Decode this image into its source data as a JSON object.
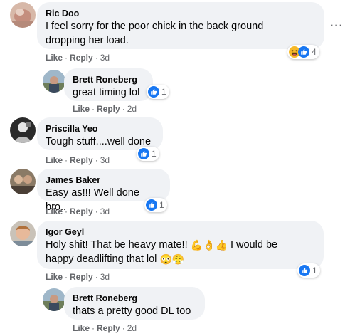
{
  "comments": [
    {
      "author": "Ric Doo",
      "text_line1": "I feel sorry for the poor chick in the back ground",
      "text_line2": "dropping her load.",
      "like": "Like",
      "reply": "Reply",
      "time": "3d",
      "reaction_count": "4",
      "reactions": [
        "haha-icon",
        "like-icon"
      ],
      "replies": [
        {
          "author": "Brett Roneberg",
          "text": "great timing lol",
          "like": "Like",
          "reply": "Reply",
          "time": "2d",
          "reaction_count": "1"
        }
      ]
    },
    {
      "author": "Priscilla Yeo",
      "text": "Tough stuff....well done",
      "like": "Like",
      "reply": "Reply",
      "time": "3d",
      "reaction_count": "1"
    },
    {
      "author": "James Baker",
      "text": "Easy as!!! Well done bro..",
      "like": "Like",
      "reply": "Reply",
      "time": "3d",
      "reaction_count": "1"
    },
    {
      "author": "Igor Geyl",
      "text_line1_a": "Holy shit! That be heavy mate!!",
      "text_line1_emoji": "💪👌👍",
      "text_line1_b": "I would be",
      "text_line2_a": "happy deadlifting that lol",
      "text_line2_emoji": "😳😤",
      "like": "Like",
      "reply": "Reply",
      "time": "3d",
      "reaction_count": "1",
      "replies": [
        {
          "author": "Brett Roneberg",
          "text": "thats a pretty good DL too",
          "like": "Like",
          "reply": "Reply",
          "time": "2d"
        }
      ]
    }
  ],
  "separator": "·",
  "more_label": "···",
  "colors": {
    "bubble": "#f0f2f5",
    "meta": "#65676b",
    "like_blue": "#1877f2",
    "haha_yellow": "#f7b928"
  }
}
